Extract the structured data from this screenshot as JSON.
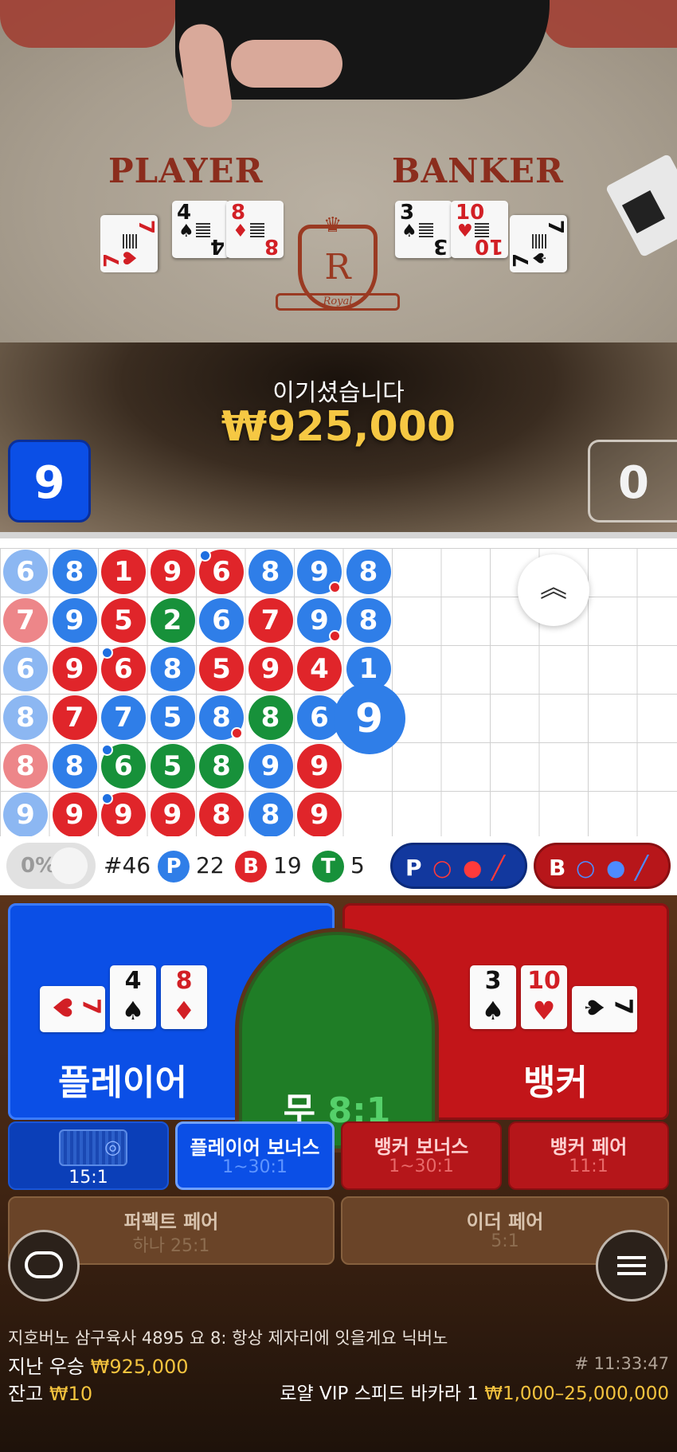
{
  "table": {
    "player_label": "PLAYER",
    "banker_label": "BANKER",
    "logo_letter": "R",
    "logo_text": "Royal",
    "player_cards": [
      {
        "rank": "7",
        "suit": "♥",
        "color": "red"
      },
      {
        "rank": "4",
        "suit": "♠",
        "color": "black"
      },
      {
        "rank": "8",
        "suit": "♦",
        "color": "red"
      }
    ],
    "banker_cards": [
      {
        "rank": "3",
        "suit": "♠",
        "color": "black"
      },
      {
        "rank": "10",
        "suit": "♥",
        "color": "red"
      },
      {
        "rank": "7",
        "suit": "♠",
        "color": "black"
      }
    ]
  },
  "result": {
    "title": "이기셨습니다",
    "amount": "₩925,000",
    "player_score": "9",
    "banker_score": "0"
  },
  "road": {
    "columns": [
      [
        "6",
        "7",
        "6",
        "8",
        "8",
        "9"
      ],
      [
        "8",
        "9",
        "9",
        "7",
        "8",
        "9"
      ],
      [
        "1",
        "5",
        "6",
        "7",
        "6",
        "9"
      ],
      [
        "9",
        "2",
        "8",
        "5",
        "5",
        "9"
      ],
      [
        "6",
        "6",
        "5",
        "8",
        "8",
        "8"
      ],
      [
        "8",
        "7",
        "9",
        "8",
        "9",
        "8"
      ],
      [
        "9",
        "9",
        "4",
        "6",
        "9",
        "9"
      ],
      [
        "8",
        "8",
        "1"
      ]
    ],
    "types": [
      [
        "P",
        "B",
        "P",
        "P",
        "B",
        "P"
      ],
      [
        "P",
        "P",
        "B",
        "B",
        "P",
        "B"
      ],
      [
        "B",
        "B",
        "B",
        "P",
        "T",
        "B"
      ],
      [
        "B",
        "T",
        "P",
        "P",
        "T",
        "B"
      ],
      [
        "B",
        "P",
        "B",
        "P",
        "T",
        "B"
      ],
      [
        "P",
        "B",
        "B",
        "T",
        "P",
        "P"
      ],
      [
        "P",
        "P",
        "B",
        "P",
        "B",
        "B"
      ],
      [
        "P",
        "P",
        "P"
      ]
    ],
    "latest": "9",
    "collapse_icon": "double-chevron-up-icon"
  },
  "stats": {
    "percent": "0%",
    "round": "#46",
    "p_label": "P",
    "p_count": "22",
    "b_label": "B",
    "b_count": "19",
    "t_label": "T",
    "t_count": "5",
    "ask_p": "P",
    "ask_b": "B"
  },
  "bets": {
    "player": "플레이어",
    "tie": "무",
    "tie_odds": "8:1",
    "banker": "뱅커",
    "player_cards": [
      {
        "rank": "7",
        "suit": "♥",
        "color": "red"
      },
      {
        "rank": "4",
        "suit": "♠",
        "color": "black"
      },
      {
        "rank": "8",
        "suit": "♦",
        "color": "red"
      }
    ],
    "banker_cards": [
      {
        "rank": "3",
        "suit": "♠",
        "color": "black"
      },
      {
        "rank": "10",
        "suit": "♥",
        "color": "red"
      },
      {
        "rank": "7",
        "suit": "♠",
        "color": "black"
      }
    ],
    "side": [
      {
        "title": "",
        "odds": "15:1"
      },
      {
        "title": "플레이어 보너스",
        "odds": "1~30:1"
      },
      {
        "title": "뱅커 보너스",
        "odds": "1~30:1"
      },
      {
        "title": "뱅커 페어",
        "odds": "11:1"
      }
    ],
    "perfect_pair": "퍼펙트 페어",
    "perfect_pair_odds": "하나 25:1",
    "either_pair": "이더 페어",
    "either_pair_odds": "5:1"
  },
  "footer": {
    "chat": "지호버노 삼구육사 4895 요 8: 항상 제자리에 잇을게요 닉버노",
    "last_win_label": "지난 우승",
    "last_win_amount": "₩925,000",
    "time": "# 11:33:47",
    "balance_label": "잔고",
    "balance_amount": "₩10",
    "table_name": "로얄 VIP 스피드 바카라 1",
    "limits": "₩1,000–25,000,000"
  },
  "colors": {
    "player": "#0b4fe6",
    "banker": "#c21519",
    "tie": "#1f7d26",
    "gold": "#f4c33e"
  }
}
